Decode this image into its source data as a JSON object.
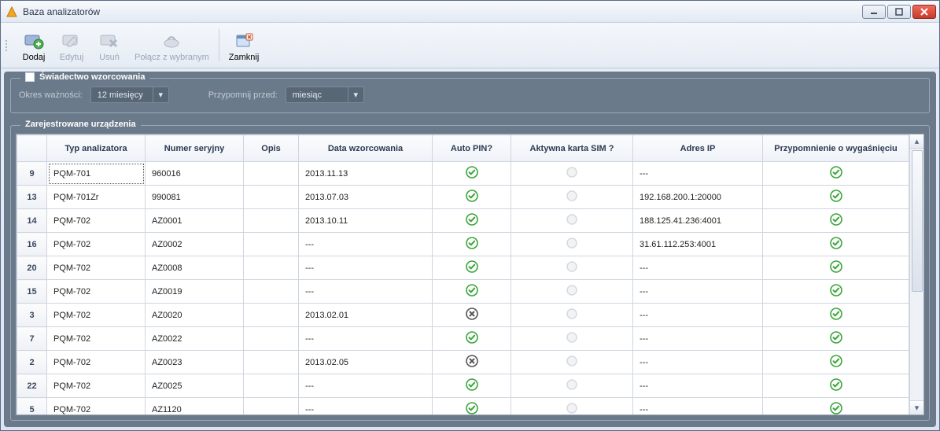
{
  "window": {
    "title": "Baza analizatorów"
  },
  "toolbar": {
    "add": "Dodaj",
    "edit": "Edytuj",
    "delete": "Usuń",
    "connect": "Połącz z wybranym",
    "close": "Zamknij"
  },
  "calibration": {
    "legend": "Świadectwo wzorcowania",
    "validity_label": "Okres ważności:",
    "validity_value": "12 miesięcy",
    "remind_label": "Przypomnij przed:",
    "remind_value": "miesiąc"
  },
  "devices": {
    "legend": "Zarejestrowane urządzenia",
    "columns": {
      "type": "Typ analizatora",
      "serial": "Numer seryjny",
      "desc": "Opis",
      "cal_date": "Data wzorcowania",
      "auto_pin": "Auto PIN?",
      "sim": "Aktywna karta SIM ?",
      "ip": "Adres IP",
      "reminder": "Przypomnienie o wygaśnięciu"
    },
    "rows": [
      {
        "n": "9",
        "type": "PQM-701",
        "serial": "960016",
        "desc": "",
        "date": "2013.11.13",
        "pin": "ok",
        "sim": "off",
        "ip": "---",
        "rem": "ok"
      },
      {
        "n": "13",
        "type": "PQM-701Zr",
        "serial": "990081",
        "desc": "",
        "date": "2013.07.03",
        "pin": "ok",
        "sim": "off",
        "ip": "192.168.200.1:20000",
        "rem": "ok"
      },
      {
        "n": "14",
        "type": "PQM-702",
        "serial": "AZ0001",
        "desc": "",
        "date": "2013.10.11",
        "pin": "ok",
        "sim": "off",
        "ip": "188.125.41.236:4001",
        "rem": "ok"
      },
      {
        "n": "16",
        "type": "PQM-702",
        "serial": "AZ0002",
        "desc": "",
        "date": "---",
        "pin": "ok",
        "sim": "off",
        "ip": "31.61.112.253:4001",
        "rem": "ok"
      },
      {
        "n": "20",
        "type": "PQM-702",
        "serial": "AZ0008",
        "desc": "",
        "date": "---",
        "pin": "ok",
        "sim": "off",
        "ip": "---",
        "rem": "ok"
      },
      {
        "n": "15",
        "type": "PQM-702",
        "serial": "AZ0019",
        "desc": "",
        "date": "---",
        "pin": "ok",
        "sim": "off",
        "ip": "---",
        "rem": "ok"
      },
      {
        "n": "3",
        "type": "PQM-702",
        "serial": "AZ0020",
        "desc": "",
        "date": "2013.02.01",
        "pin": "x",
        "sim": "off",
        "ip": "---",
        "rem": "ok"
      },
      {
        "n": "7",
        "type": "PQM-702",
        "serial": "AZ0022",
        "desc": "",
        "date": "---",
        "pin": "ok",
        "sim": "off",
        "ip": "---",
        "rem": "ok"
      },
      {
        "n": "2",
        "type": "PQM-702",
        "serial": "AZ0023",
        "desc": "",
        "date": "2013.02.05",
        "pin": "x",
        "sim": "off",
        "ip": "---",
        "rem": "ok"
      },
      {
        "n": "22",
        "type": "PQM-702",
        "serial": "AZ0025",
        "desc": "",
        "date": "---",
        "pin": "ok",
        "sim": "off",
        "ip": "---",
        "rem": "ok"
      },
      {
        "n": "5",
        "type": "PQM-702",
        "serial": "AZ1120",
        "desc": "",
        "date": "---",
        "pin": "ok",
        "sim": "off",
        "ip": "---",
        "rem": "ok"
      }
    ]
  }
}
